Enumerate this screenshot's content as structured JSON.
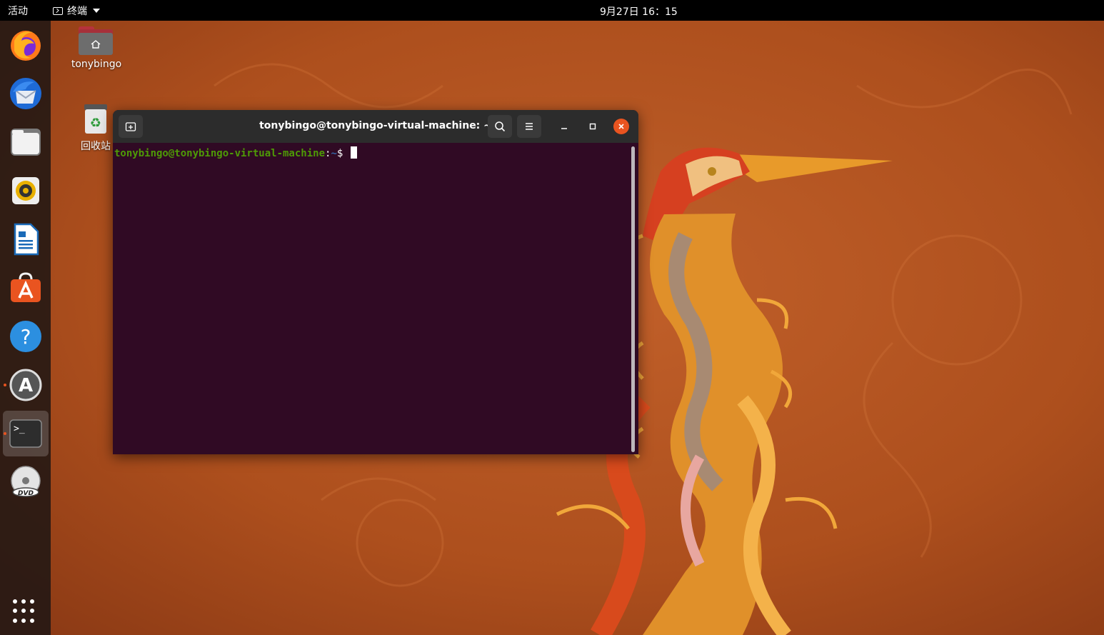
{
  "topbar": {
    "activities": "活动",
    "app_name": "终端",
    "clock": "9月27日  16：15"
  },
  "dock": {
    "items": [
      {
        "name": "firefox",
        "icon": "firefox-icon"
      },
      {
        "name": "thunderbird",
        "icon": "thunderbird-icon"
      },
      {
        "name": "files",
        "icon": "files-icon"
      },
      {
        "name": "rhythmbox",
        "icon": "rhythmbox-icon"
      },
      {
        "name": "libreoffice-writer",
        "icon": "writer-icon"
      },
      {
        "name": "ubuntu-software",
        "icon": "software-icon"
      },
      {
        "name": "help",
        "icon": "help-icon",
        "glyph": "?"
      },
      {
        "name": "software-updater",
        "icon": "updater-icon",
        "glyph": "A"
      },
      {
        "name": "terminal",
        "icon": "terminal-icon",
        "glyph": ">_"
      },
      {
        "name": "dvd",
        "icon": "dvd-icon",
        "glyph": "DVD"
      }
    ],
    "show_apps_icon": "app-grid-icon"
  },
  "desktop": {
    "home_label": "tonybingo",
    "trash_label": "回收站"
  },
  "terminal": {
    "title": "tonybingo@tonybingo-virtual-machine: ~",
    "prompt_user": "tonybingo@tonybingo-virtual-machine",
    "prompt_sep": ":",
    "prompt_path": "~",
    "prompt_symbol": "$ "
  },
  "colors": {
    "accent": "#e95420",
    "terminal_bg": "#300a24",
    "prompt_user": "#4e9a06",
    "prompt_path": "#3465a4"
  }
}
